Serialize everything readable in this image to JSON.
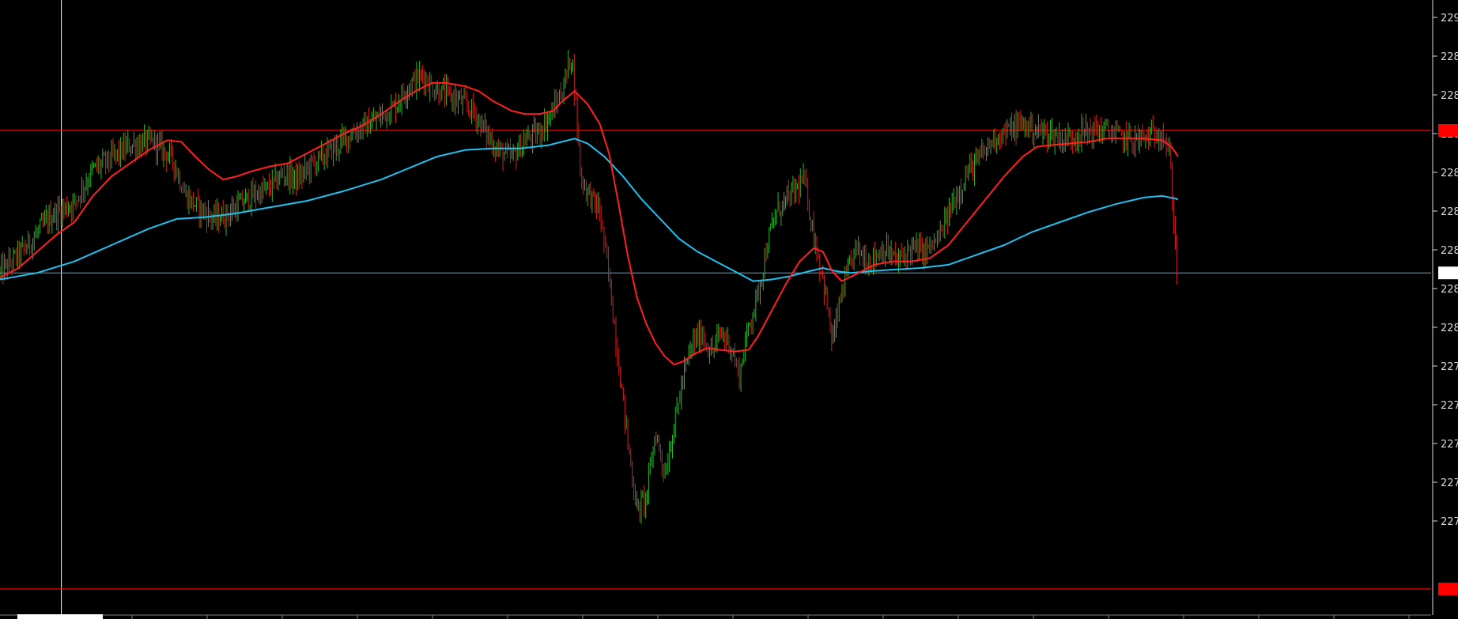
{
  "chart_data": {
    "type": "candlestick",
    "title": "",
    "xlabel": "",
    "ylabel": "",
    "background": "#000000",
    "colors": {
      "up": "#2db52d",
      "down": "#d02020",
      "ma_fast": "#ff2020",
      "ma_slow": "#22c0ee",
      "level_line": "#ff0000",
      "cursor_line": "#ffffff",
      "axis": "#d8d8d8"
    },
    "y_ticks": [
      "229",
      "228",
      "228",
      "228",
      "228",
      "228",
      "228",
      "228",
      "228",
      "227",
      "227",
      "227",
      "227",
      "227"
    ],
    "close_path": [
      [
        0,
        0.265
      ],
      [
        30,
        0.35
      ],
      [
        55,
        0.44
      ],
      [
        80,
        0.48
      ],
      [
        100,
        0.58
      ],
      [
        120,
        0.615
      ],
      [
        140,
        0.655
      ],
      [
        165,
        0.665
      ],
      [
        185,
        0.615
      ],
      [
        200,
        0.5
      ],
      [
        215,
        0.46
      ],
      [
        230,
        0.43
      ],
      [
        245,
        0.445
      ],
      [
        260,
        0.48
      ],
      [
        275,
        0.505
      ],
      [
        290,
        0.525
      ],
      [
        305,
        0.57
      ],
      [
        320,
        0.55
      ],
      [
        335,
        0.595
      ],
      [
        350,
        0.625
      ],
      [
        365,
        0.66
      ],
      [
        380,
        0.695
      ],
      [
        395,
        0.715
      ],
      [
        410,
        0.745
      ],
      [
        425,
        0.775
      ],
      [
        440,
        0.84
      ],
      [
        455,
        0.87
      ],
      [
        465,
        0.83
      ],
      [
        480,
        0.81
      ],
      [
        495,
        0.79
      ],
      [
        510,
        0.755
      ],
      [
        520,
        0.705
      ],
      [
        535,
        0.64
      ],
      [
        550,
        0.615
      ],
      [
        565,
        0.67
      ],
      [
        580,
        0.695
      ],
      [
        595,
        0.76
      ],
      [
        605,
        0.825
      ],
      [
        615,
        0.935
      ],
      [
        625,
        0.55
      ],
      [
        635,
        0.5
      ],
      [
        645,
        0.45
      ],
      [
        655,
        0.25
      ],
      [
        665,
        0.0
      ],
      [
        675,
        -0.25
      ],
      [
        685,
        -0.46
      ],
      [
        695,
        -0.42
      ],
      [
        705,
        -0.22
      ],
      [
        715,
        -0.35
      ],
      [
        725,
        -0.2
      ],
      [
        735,
        -0.05
      ],
      [
        745,
        0.05
      ],
      [
        755,
        0.08
      ],
      [
        765,
        0.02
      ],
      [
        775,
        0.08
      ],
      [
        785,
        0.05
      ],
      [
        795,
        -0.05
      ],
      [
        805,
        0.1
      ],
      [
        815,
        0.2
      ],
      [
        825,
        0.35
      ],
      [
        835,
        0.45
      ],
      [
        850,
        0.5
      ],
      [
        865,
        0.55
      ],
      [
        875,
        0.38
      ],
      [
        885,
        0.25
      ],
      [
        895,
        0.05
      ],
      [
        905,
        0.2
      ],
      [
        920,
        0.34
      ],
      [
        935,
        0.3
      ],
      [
        950,
        0.34
      ],
      [
        965,
        0.3
      ],
      [
        980,
        0.34
      ],
      [
        995,
        0.33
      ],
      [
        1010,
        0.37
      ],
      [
        1025,
        0.48
      ],
      [
        1040,
        0.57
      ],
      [
        1055,
        0.62
      ],
      [
        1070,
        0.68
      ],
      [
        1085,
        0.7
      ],
      [
        1100,
        0.72
      ],
      [
        1115,
        0.7
      ],
      [
        1130,
        0.69
      ],
      [
        1145,
        0.67
      ],
      [
        1160,
        0.69
      ],
      [
        1175,
        0.7
      ],
      [
        1190,
        0.7
      ],
      [
        1205,
        0.68
      ],
      [
        1220,
        0.67
      ],
      [
        1235,
        0.68
      ],
      [
        1250,
        0.7
      ],
      [
        1258,
        0.62
      ],
      [
        1263,
        0.4
      ],
      [
        1267,
        0.2
      ]
    ],
    "ma_fast_path": [
      [
        0,
        0.25
      ],
      [
        20,
        0.28
      ],
      [
        40,
        0.33
      ],
      [
        60,
        0.38
      ],
      [
        80,
        0.42
      ],
      [
        100,
        0.5
      ],
      [
        120,
        0.56
      ],
      [
        140,
        0.6
      ],
      [
        160,
        0.64
      ],
      [
        180,
        0.67
      ],
      [
        195,
        0.665
      ],
      [
        210,
        0.62
      ],
      [
        225,
        0.58
      ],
      [
        240,
        0.55
      ],
      [
        255,
        0.56
      ],
      [
        270,
        0.575
      ],
      [
        290,
        0.59
      ],
      [
        310,
        0.6
      ],
      [
        330,
        0.63
      ],
      [
        350,
        0.66
      ],
      [
        370,
        0.69
      ],
      [
        390,
        0.715
      ],
      [
        410,
        0.75
      ],
      [
        430,
        0.79
      ],
      [
        450,
        0.825
      ],
      [
        465,
        0.845
      ],
      [
        480,
        0.845
      ],
      [
        500,
        0.835
      ],
      [
        515,
        0.82
      ],
      [
        530,
        0.79
      ],
      [
        550,
        0.76
      ],
      [
        565,
        0.75
      ],
      [
        580,
        0.75
      ],
      [
        595,
        0.76
      ],
      [
        605,
        0.79
      ],
      [
        618,
        0.82
      ],
      [
        632,
        0.78
      ],
      [
        645,
        0.72
      ],
      [
        655,
        0.63
      ],
      [
        665,
        0.48
      ],
      [
        675,
        0.32
      ],
      [
        685,
        0.19
      ],
      [
        695,
        0.11
      ],
      [
        705,
        0.05
      ],
      [
        715,
        0.01
      ],
      [
        725,
        -0.015
      ],
      [
        735,
        -0.005
      ],
      [
        745,
        0.015
      ],
      [
        760,
        0.035
      ],
      [
        775,
        0.03
      ],
      [
        790,
        0.025
      ],
      [
        805,
        0.03
      ],
      [
        815,
        0.07
      ],
      [
        830,
        0.15
      ],
      [
        845,
        0.23
      ],
      [
        860,
        0.3
      ],
      [
        875,
        0.34
      ],
      [
        885,
        0.33
      ],
      [
        895,
        0.27
      ],
      [
        905,
        0.24
      ],
      [
        920,
        0.26
      ],
      [
        940,
        0.29
      ],
      [
        960,
        0.3
      ],
      [
        980,
        0.3
      ],
      [
        1000,
        0.31
      ],
      [
        1020,
        0.35
      ],
      [
        1040,
        0.42
      ],
      [
        1060,
        0.49
      ],
      [
        1080,
        0.56
      ],
      [
        1100,
        0.62
      ],
      [
        1115,
        0.65
      ],
      [
        1130,
        0.655
      ],
      [
        1150,
        0.66
      ],
      [
        1170,
        0.665
      ],
      [
        1190,
        0.675
      ],
      [
        1210,
        0.675
      ],
      [
        1230,
        0.675
      ],
      [
        1250,
        0.67
      ],
      [
        1260,
        0.65
      ],
      [
        1267,
        0.62
      ]
    ],
    "ma_slow_path": [
      [
        0,
        0.245
      ],
      [
        40,
        0.265
      ],
      [
        80,
        0.3
      ],
      [
        120,
        0.35
      ],
      [
        160,
        0.4
      ],
      [
        190,
        0.43
      ],
      [
        220,
        0.435
      ],
      [
        250,
        0.445
      ],
      [
        290,
        0.465
      ],
      [
        330,
        0.485
      ],
      [
        370,
        0.515
      ],
      [
        410,
        0.55
      ],
      [
        440,
        0.585
      ],
      [
        470,
        0.62
      ],
      [
        500,
        0.64
      ],
      [
        530,
        0.645
      ],
      [
        560,
        0.645
      ],
      [
        590,
        0.655
      ],
      [
        618,
        0.675
      ],
      [
        632,
        0.66
      ],
      [
        650,
        0.62
      ],
      [
        670,
        0.56
      ],
      [
        690,
        0.49
      ],
      [
        710,
        0.43
      ],
      [
        730,
        0.37
      ],
      [
        750,
        0.33
      ],
      [
        770,
        0.3
      ],
      [
        790,
        0.27
      ],
      [
        810,
        0.24
      ],
      [
        830,
        0.245
      ],
      [
        850,
        0.255
      ],
      [
        870,
        0.27
      ],
      [
        885,
        0.28
      ],
      [
        900,
        0.27
      ],
      [
        915,
        0.265
      ],
      [
        935,
        0.27
      ],
      [
        960,
        0.275
      ],
      [
        990,
        0.28
      ],
      [
        1020,
        0.29
      ],
      [
        1050,
        0.32
      ],
      [
        1080,
        0.35
      ],
      [
        1110,
        0.39
      ],
      [
        1140,
        0.42
      ],
      [
        1170,
        0.45
      ],
      [
        1200,
        0.475
      ],
      [
        1230,
        0.495
      ],
      [
        1250,
        0.5
      ],
      [
        1267,
        0.49
      ]
    ],
    "upper_level": 0.7,
    "lower_level": -0.7,
    "current_level": 0.265,
    "cursor_x": 66
  }
}
